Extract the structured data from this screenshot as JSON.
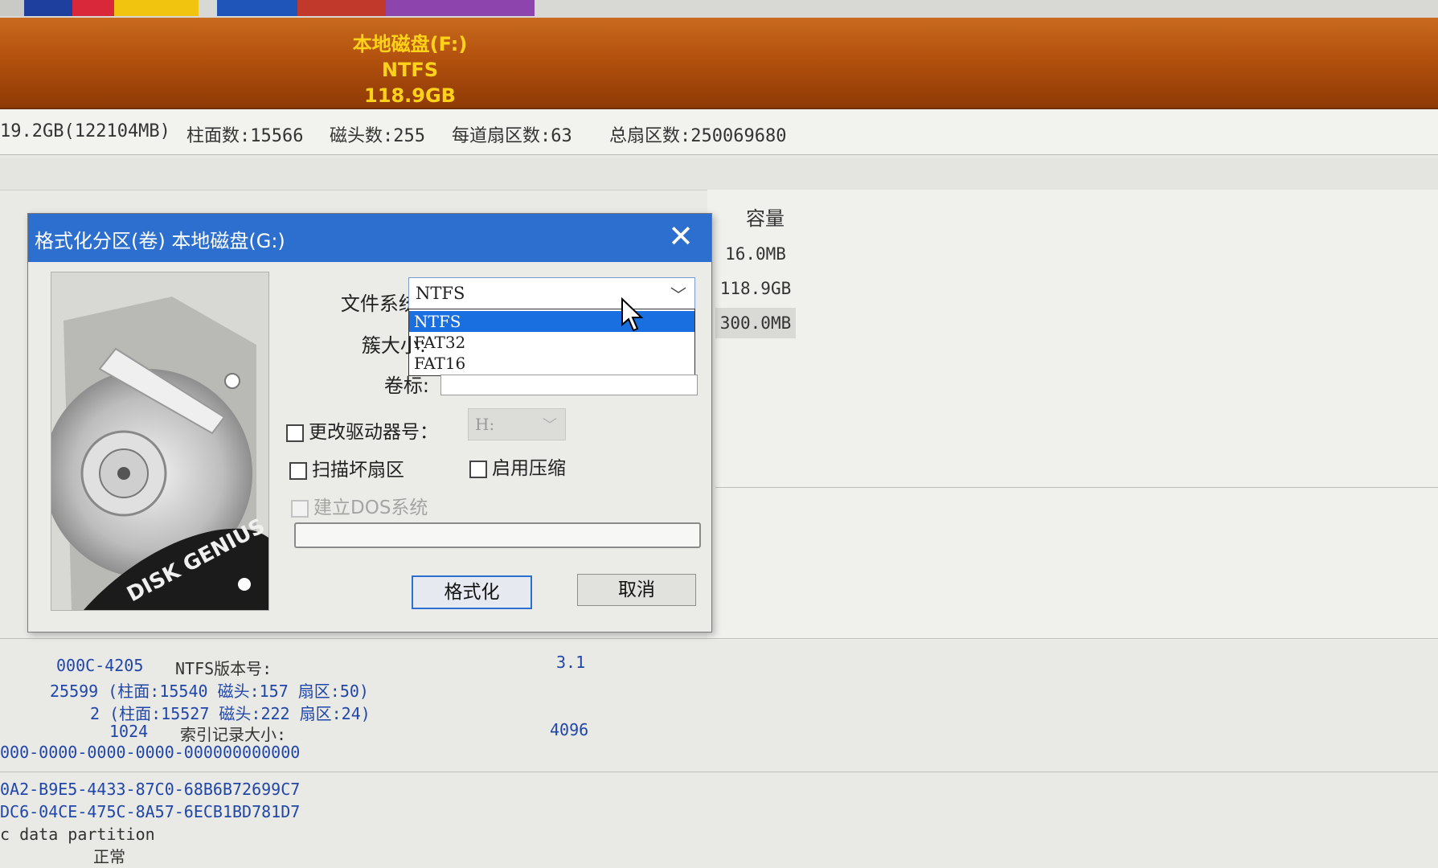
{
  "disk_bar": {
    "partition_name": "本地磁盘(F:)",
    "filesystem": "NTFS",
    "size": "118.9GB"
  },
  "disk_info": {
    "capacity": "19.2GB(122104MB)",
    "cylinders": "柱面数:15566",
    "heads": "磁头数:255",
    "sectors_per_track": "每道扇区数:63",
    "total_sectors": "总扇区数:250069680"
  },
  "partition_table": {
    "capacity_header": "容量",
    "capacities": [
      "16.0MB",
      "118.9GB",
      "300.0MB"
    ],
    "selected_index": 2
  },
  "dialog": {
    "title": "格式化分区(卷) 本地磁盘(G:)",
    "close_glyph": "✕",
    "filesystem_label": "文件系统:",
    "filesystem_value": "NTFS",
    "filesystem_options": [
      "NTFS",
      "FAT32",
      "FAT16"
    ],
    "cluster_label": "簇大小:",
    "volume_label": "卷标:",
    "change_drive_letter": "更改驱动器号：",
    "drive_letter_value": "H:",
    "scan_bad_sectors": "扫描坏扇区",
    "enable_compression": "启用压缩",
    "create_dos": "建立DOS系统",
    "format_button": "格式化",
    "cancel_button": "取消",
    "art_text": "DISK GENIUS",
    "progress": 0
  },
  "details": {
    "line1_a": "000C-4205",
    "line1_b": "NTFS版本号:",
    "line1_c": "3.1",
    "line2": "25599 (柱面:15540 磁头:157 扇区:50)",
    "line3": "2 (柱面:15527 磁头:222 扇区:24)",
    "line4_a": "1024",
    "line4_b": "索引记录大小:",
    "line4_c": "4096",
    "line5": "000-0000-0000-0000-000000000000",
    "line6": "0A2-B9E5-4433-87C0-68B6B72699C7",
    "line7": "DC6-04CE-475C-8A57-6ECB1BD781D7",
    "line8": "c data partition",
    "line9": "正常"
  },
  "colors": {
    "title_bar": "#2c6fcf",
    "disk_bar": "#b3510e",
    "disk_label": "#ffd21a",
    "selection": "#1a6fe0",
    "info_text": "#2046a8"
  }
}
